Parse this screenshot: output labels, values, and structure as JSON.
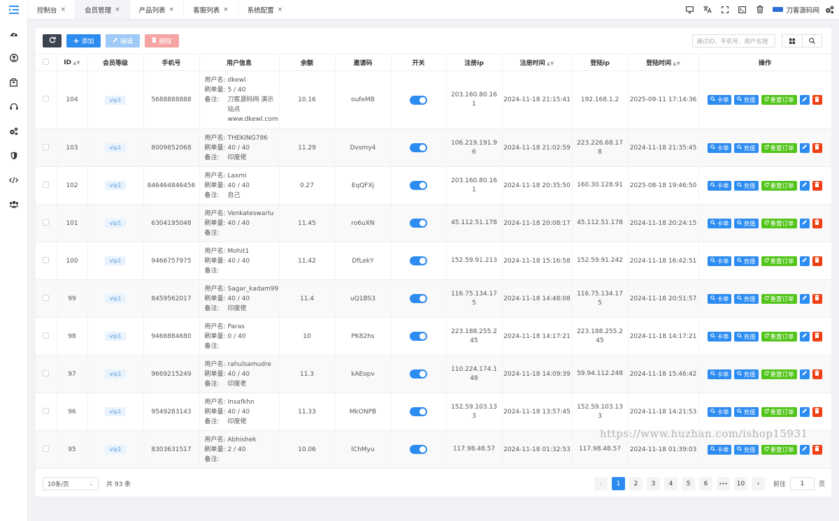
{
  "sidebar": {
    "toggle_icon": "menu-fold-icon",
    "items": [
      {
        "icon": "dashboard-icon"
      },
      {
        "icon": "user-circle-icon"
      },
      {
        "icon": "package-icon"
      },
      {
        "icon": "headset-icon"
      },
      {
        "icon": "gears-icon"
      },
      {
        "icon": "shield-icon"
      },
      {
        "icon": "code-icon"
      },
      {
        "icon": "users-icon"
      }
    ]
  },
  "tabs": [
    {
      "label": "控制台"
    },
    {
      "label": "会员管理",
      "active": true
    },
    {
      "label": "产品列表"
    },
    {
      "label": "客服列表"
    },
    {
      "label": "系统配置"
    }
  ],
  "tab_close": "×",
  "brand": {
    "name": "刀客源码网"
  },
  "toolbar": {
    "add": "添加",
    "edit": "编辑",
    "delete": "删除",
    "search_placeholder": "通过ID、手机号、用户名搜"
  },
  "table": {
    "headers": [
      "ID",
      "会员等级",
      "手机号",
      "用户信息",
      "余额",
      "邀请码",
      "开关",
      "注册ip",
      "注册时间",
      "登陆ip",
      "登陆时间",
      "操作"
    ],
    "info_labels": {
      "username": "用户名:",
      "orders": "刷单量:",
      "note": "备注:"
    },
    "actions": {
      "card": "卡单",
      "recharge": "充值",
      "reset": "重置订单"
    },
    "rows": [
      {
        "id": "104",
        "level": "vip1",
        "phone": "5688888888",
        "username": "dkewl",
        "orders": "5 / 40",
        "note": "刀客源码网 演示站点 www.dkewl.com",
        "balance": "10.16",
        "invite": "oufeMB",
        "enabled": true,
        "reg_ip": "203.160.80.161",
        "reg_time": "2024-11-18 21:15:41",
        "login_ip": "192.168.1.2",
        "login_time": "2025-09-11 17:14:36"
      },
      {
        "id": "103",
        "level": "vip1",
        "phone": "8009852068",
        "username": "THEKING786",
        "orders": "40 / 40",
        "note": "印度佬",
        "balance": "11.29",
        "invite": "Dvsmy4",
        "enabled": true,
        "reg_ip": "106.219.191.96",
        "reg_time": "2024-11-18 21:02:59",
        "login_ip": "223.226.68.178",
        "login_time": "2024-11-18 21:35:45"
      },
      {
        "id": "102",
        "level": "vip1",
        "phone": "846464846456",
        "username": "Laxmi",
        "orders": "40 / 40",
        "note": "自己",
        "balance": "0.27",
        "invite": "EqQFXj",
        "enabled": true,
        "reg_ip": "203.160.80.161",
        "reg_time": "2024-11-18 20:35:50",
        "login_ip": "160.30.128.91",
        "login_time": "2025-08-18 19:46:50"
      },
      {
        "id": "101",
        "level": "vip1",
        "phone": "6304195048",
        "username": "Venkateswarlu",
        "orders": "40 / 40",
        "note": "",
        "balance": "11.45",
        "invite": "ro6uXN",
        "enabled": true,
        "reg_ip": "45.112.51.178",
        "reg_time": "2024-11-18 20:08:17",
        "login_ip": "45.112.51.178",
        "login_time": "2024-11-18 20:24:15"
      },
      {
        "id": "100",
        "level": "vip1",
        "phone": "9466757975",
        "username": "Mohit1",
        "orders": "40 / 40",
        "note": "",
        "balance": "11.42",
        "invite": "DfLekY",
        "enabled": true,
        "reg_ip": "152.59.91.213",
        "reg_time": "2024-11-18 15:16:58",
        "login_ip": "152.59.91.242",
        "login_time": "2024-11-18 16:42:51"
      },
      {
        "id": "99",
        "level": "vip1",
        "phone": "8459562017",
        "username": "Sagar_kadam99",
        "orders": "40 / 40",
        "note": "印度佬",
        "balance": "11.4",
        "invite": "uQ1BS3",
        "enabled": true,
        "reg_ip": "116.75.134.175",
        "reg_time": "2024-11-18 14:48:08",
        "login_ip": "116.75.134.175",
        "login_time": "2024-11-18 20:51:57"
      },
      {
        "id": "98",
        "level": "vip1",
        "phone": "9466884680",
        "username": "Paras",
        "orders": "0 / 40",
        "note": "",
        "balance": "10",
        "invite": "PK82hs",
        "enabled": true,
        "reg_ip": "223.188.255.245",
        "reg_time": "2024-11-18 14:17:21",
        "login_ip": "223.188.255.245",
        "login_time": "2024-11-18 14:17:21"
      },
      {
        "id": "97",
        "level": "vip1",
        "phone": "9669215249",
        "username": "rahulsamudre",
        "orders": "40 / 40",
        "note": "印度老",
        "balance": "11.3",
        "invite": "kAEopv",
        "enabled": true,
        "reg_ip": "110.224.174.148",
        "reg_time": "2024-11-18 14:09:39",
        "login_ip": "59.94.112.248",
        "login_time": "2024-11-18 15:46:42"
      },
      {
        "id": "96",
        "level": "vip1",
        "phone": "9549283143",
        "username": "Insafkhn",
        "orders": "40 / 40",
        "note": "印度佬",
        "balance": "11.33",
        "invite": "MkONPB",
        "enabled": true,
        "reg_ip": "152.59.103.133",
        "reg_time": "2024-11-18 13:57:45",
        "login_ip": "152.59.103.133",
        "login_time": "2024-11-18 14:21:53"
      },
      {
        "id": "95",
        "level": "vip1",
        "phone": "8303631517",
        "username": "Abhishek",
        "orders": "2 / 40",
        "note": "",
        "balance": "10.06",
        "invite": "IChMyu",
        "enabled": true,
        "reg_ip": "117.98.48.57",
        "reg_time": "2024-11-18 01:32:53",
        "login_ip": "117.98.48.57",
        "login_time": "2024-11-18 01:39:03"
      }
    ]
  },
  "footer": {
    "page_size": "10条/页",
    "total": "共 93 条",
    "pages": [
      "1",
      "2",
      "3",
      "4",
      "5",
      "6",
      "•••",
      "10"
    ],
    "current_page": "1",
    "prev": "‹",
    "next": "›",
    "goto_label": "前往",
    "goto_value": "1",
    "goto_unit": "页"
  },
  "watermark": "https://www.huzhan.com/ishop15931",
  "colors": {
    "primary": "#2d8cf0",
    "success": "#52c41a",
    "danger": "#ed4014",
    "dark": "#3c4350"
  }
}
